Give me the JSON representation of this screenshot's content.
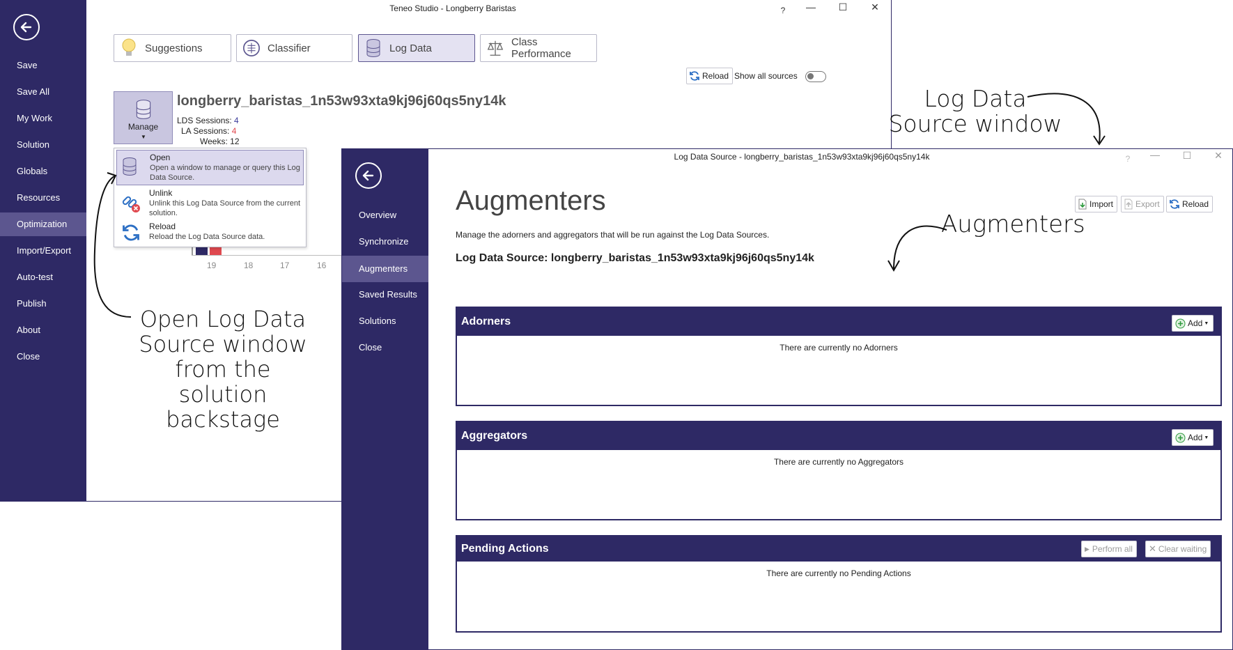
{
  "main_window": {
    "title": "Teneo Studio - Longberry Baristas",
    "controls": {
      "help": "?",
      "minimize": "—",
      "maximize": "☐",
      "close": "✕"
    },
    "sidebar_items": [
      "Save",
      "Save All",
      "My Work",
      "Solution",
      "Globals",
      "Resources",
      "Optimization",
      "Import/Export",
      "Auto-test",
      "Publish",
      "About",
      "Close"
    ],
    "active_sidebar_item": "Optimization",
    "tabs": [
      {
        "label": "Suggestions",
        "icon": "lightbulb-icon"
      },
      {
        "label": "Classifier",
        "icon": "brain-icon"
      },
      {
        "label": "Log Data",
        "icon": "database-icon"
      },
      {
        "label": "Class Performance",
        "icon": "scales-icon"
      }
    ],
    "active_tab": "Log Data",
    "reload_label": "Reload",
    "show_all_sources_label": "Show all sources",
    "data_source": {
      "name": "longberry_baristas_1n53w93xta9kj96j60qs5ny14k",
      "manage_label": "Manage",
      "stats": [
        {
          "label": "LDS Sessions:",
          "value": "4"
        },
        {
          "label": "LA Sessions:",
          "value": "4"
        },
        {
          "label": "Weeks:",
          "value": "12"
        }
      ]
    },
    "manage_menu": [
      {
        "title": "Open",
        "desc": "Open a window to manage or query this Log Data Source."
      },
      {
        "title": "Unlink",
        "desc": "Unlink this Log Data Source from the current solution."
      },
      {
        "title": "Reload",
        "desc": "Reload the Log Data Source data."
      }
    ],
    "chart_ticks": [
      "19",
      "18",
      "17",
      "16"
    ]
  },
  "annotations": {
    "lds_window": [
      "Log Data",
      "Source window"
    ],
    "open_lds": [
      "Open Log Data",
      "Source window",
      "from the",
      "solution",
      "backstage"
    ],
    "augmenters": "Augmenters"
  },
  "lds_window": {
    "title": "Log Data Source - longberry_baristas_1n53w93xta9kj96j60qs5ny14k",
    "controls": {
      "help": "?",
      "minimize": "—",
      "maximize": "☐",
      "close": "✕"
    },
    "sidebar_items": [
      "Overview",
      "Synchronize",
      "Augmenters",
      "Saved Results",
      "Solutions",
      "Close"
    ],
    "active_sidebar_item": "Augmenters",
    "heading": "Augmenters",
    "description": "Manage the adorners and aggregators that will be run against the Log Data Sources.",
    "source_line": "Log Data Source: longberry_baristas_1n53w93xta9kj96j60qs5ny14k",
    "toolbar": {
      "import": "Import",
      "export": "Export",
      "reload": "Reload"
    },
    "sections": {
      "adorners": {
        "title": "Adorners",
        "add": "Add",
        "empty": "There are currently no Adorners"
      },
      "aggregators": {
        "title": "Aggregators",
        "add": "Add",
        "empty": "There are currently no Aggregators"
      },
      "pending": {
        "title": "Pending Actions",
        "perform_all": "Perform all",
        "clear_waiting": "Clear waiting",
        "empty": "There are currently no Pending Actions"
      }
    }
  },
  "colors": {
    "accent": "#2e2965",
    "active_item": "#5c568f",
    "highlight": "#dcd9ee",
    "red_value": "#e0494f"
  }
}
